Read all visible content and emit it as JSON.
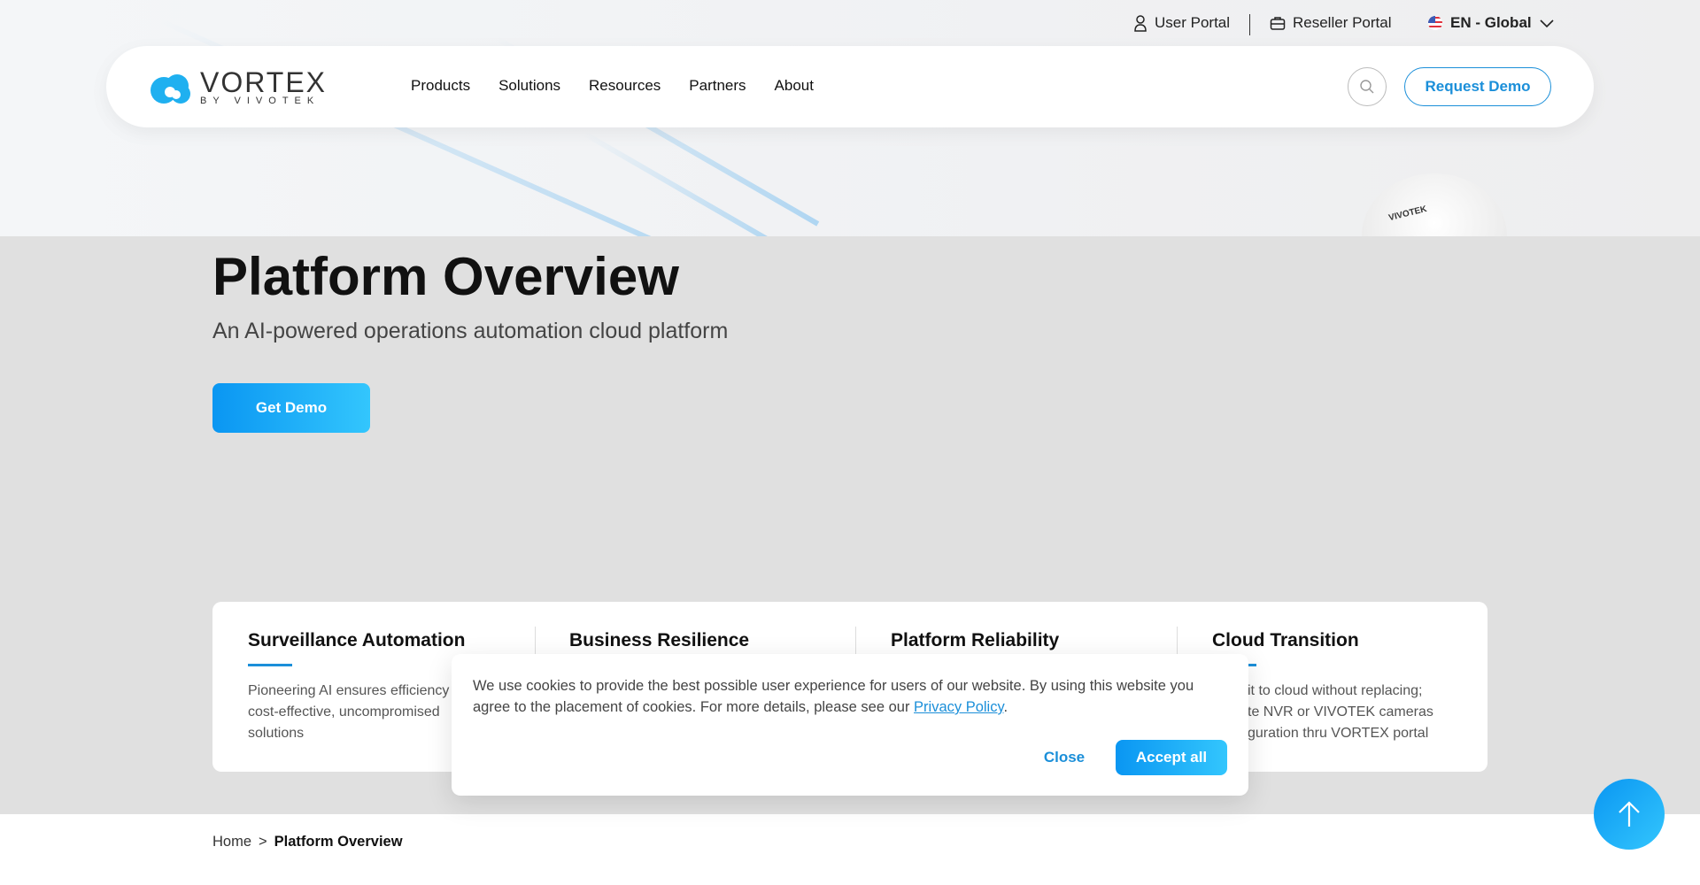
{
  "brand": {
    "name": "VORTEX",
    "tagline": "BY VIVOTEK",
    "accent": "#1b8fd9"
  },
  "utility": {
    "user_portal": "User Portal",
    "reseller_portal": "Reseller Portal",
    "language": "EN - Global"
  },
  "nav": {
    "items": [
      "Products",
      "Solutions",
      "Resources",
      "Partners",
      "About"
    ],
    "request_demo": "Request Demo"
  },
  "hero": {
    "title": "Platform Overview",
    "subtitle": "An AI-powered operations automation cloud platform",
    "cta": "Get Demo",
    "camera_brand": "VIVOTEK"
  },
  "features": [
    {
      "title": "Surveillance Automation",
      "lines": [
        "Pioneering AI ensures efficiency",
        "cost-effective, uncompromised",
        "solutions"
      ]
    },
    {
      "title": "Business Resilience",
      "lines": []
    },
    {
      "title": "Platform Reliability",
      "lines": []
    },
    {
      "title": "Cloud Transition",
      "lines": [
        "it to cloud without replacing;",
        "te NVR or VIVOTEK cameras",
        "guration thru VORTEX portal"
      ]
    }
  ],
  "cookie": {
    "text": "We use cookies to provide the best possible user experience for users of our website. By using this website you agree to the placement of cookies. For more details, please see our ",
    "link": "Privacy Policy",
    "end": ".",
    "close": "Close",
    "accept": "Accept all"
  },
  "breadcrumb": {
    "home": "Home",
    "sep": ">",
    "current": "Platform Overview"
  }
}
